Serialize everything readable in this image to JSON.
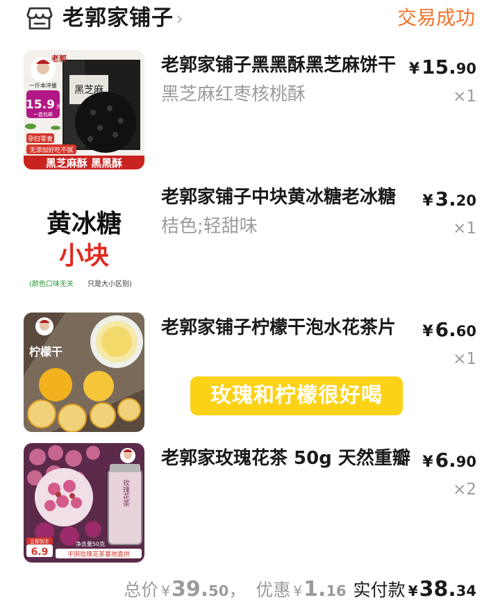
{
  "header": {
    "shop_name": "老郭家铺子",
    "arrow": "›",
    "status": "交易成功",
    "status_color": "#f0742c"
  },
  "items": [
    {
      "title": "老郭家铺子黑黑酥黑芝麻饼干",
      "sku": "黑芝麻红枣核桃酥",
      "price": {
        "currency": "¥",
        "int": "15.",
        "dec": "90"
      },
      "qty": "×1",
      "thumb": {
        "top_text": "一斤本冲量",
        "badge": "15.9",
        "badge_unit": "元",
        "badge_sub": "一盒包邮",
        "box_label": "黑芝麻",
        "tag1": "孕妇零食",
        "tag2": "无添加好吃不腻",
        "banner": "黑芝麻酥 黑黑酥"
      }
    },
    {
      "title": "老郭家铺子中块黄冰糖老冰糖",
      "sku": "桔色;轻甜味",
      "price": {
        "currency": "¥",
        "int": "3.",
        "dec": "20"
      },
      "qty": "×1",
      "thumb": {
        "line1": "黄冰糖",
        "line2": "小块",
        "note_red": "(颜色口味无关",
        "note_gray": "只是大小区别)"
      }
    },
    {
      "title": "老郭家铺子柠檬干泡水花茶片",
      "sku": "",
      "price": {
        "currency": "¥",
        "int": "6.",
        "dec": "60"
      },
      "qty": "×1",
      "thumb": {
        "label": "柠檬干"
      }
    },
    {
      "title": "老郭家玫瑰花茶 50g 天然重瓣",
      "sku": "",
      "price": {
        "currency": "¥",
        "int": "6.",
        "dec": "90"
      },
      "qty": "×2",
      "thumb": {
        "jar_label": "玫瑰花茶",
        "price_tag_top": "立即到手",
        "price_tag": "6.9",
        "net_weight": "净含量50克",
        "bottom_text": "平阴玫瑰花茶基地直供"
      }
    }
  ],
  "review_pill": "玫瑰和柠檬很好喝",
  "footer": {
    "total_label": "总价",
    "total_cur": "¥",
    "total_int": "39.",
    "total_dec": "50",
    "sep": "，",
    "discount_label": "优惠",
    "discount_cur": "¥",
    "discount_int": "1.",
    "discount_dec": "16",
    "paid_label": "实付款",
    "paid_cur": "¥",
    "paid_int": "38.",
    "paid_dec": "34"
  }
}
